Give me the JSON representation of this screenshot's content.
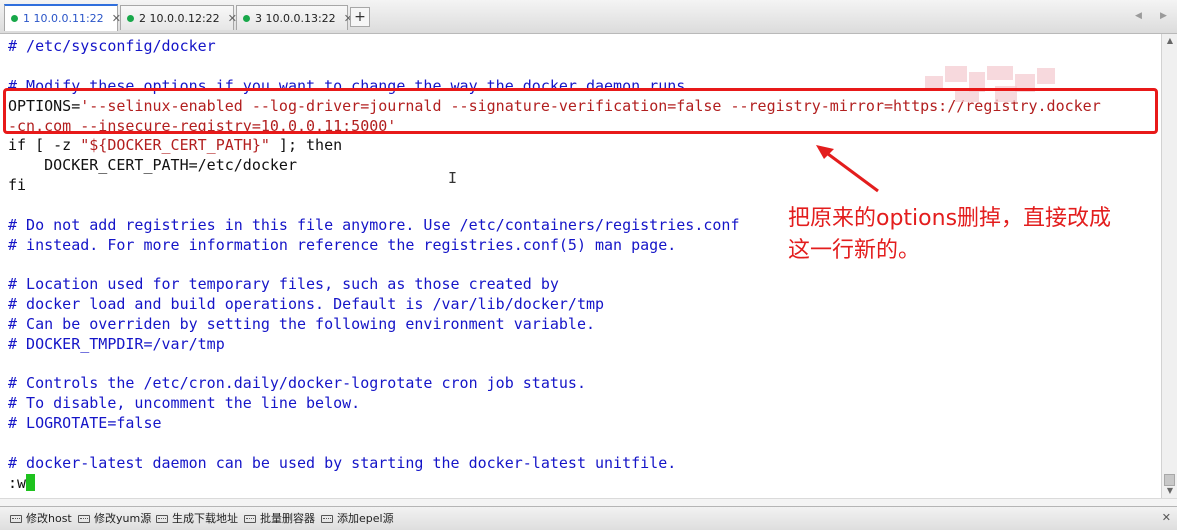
{
  "tabs": [
    {
      "label": "1 10.0.0.11:22",
      "active": true
    },
    {
      "label": "2 10.0.0.12:22",
      "active": false
    },
    {
      "label": "3 10.0.0.13:22",
      "active": false
    }
  ],
  "tab_add_label": "+",
  "tab_nav": {
    "left": "◀",
    "right": "▶"
  },
  "terminal": {
    "lines": [
      "# /etc/sysconfig/docker",
      "",
      "# Modify these options if you want to change the way the docker daemon runs",
      "OPTIONS=",
      "'--selinux-enabled --log-driver=journald --signature-verification=false --registry-mirror=https://registry.docker",
      "-cn.com --insecure-registry=10.0.0.11:5000'",
      "if [ -z ",
      "\"${DOCKER_CERT_PATH}\"",
      " ]; then",
      "    DOCKER_CERT_PATH=/etc/docker",
      "fi",
      "",
      "# Do not add registries in this file anymore. Use /etc/containers/registries.conf",
      "# instead. For more information reference the registries.conf(5) man page.",
      "",
      "# Location used for temporary files, such as those created by",
      "# docker load and build operations. Default is /var/lib/docker/tmp",
      "# Can be overriden by setting the following environment variable.",
      "# DOCKER_TMPDIR=/var/tmp",
      "",
      "# Controls the /etc/cron.daily/docker-logrotate cron job status.",
      "# To disable, uncomment the line below.",
      "# LOGROTATE=false",
      "",
      "# docker-latest daemon can be used by starting the docker-latest unitfile.",
      ":w"
    ]
  },
  "annotation": {
    "text_line1": "把原来的options删掉，直接改成",
    "text_line2": "这一行新的。",
    "color": "#e31d1d"
  },
  "bottom_bar": {
    "buttons": [
      "修改host",
      "修改yum源",
      "生成下载地址",
      "批量删容器",
      "添加epel源"
    ],
    "close": "✕"
  },
  "colors": {
    "comment": "#1515c8",
    "string": "#b21f1f",
    "cursor": "#1ec21e",
    "highlight_border": "#e81919",
    "active_tab_accent": "#2f6fdd"
  }
}
